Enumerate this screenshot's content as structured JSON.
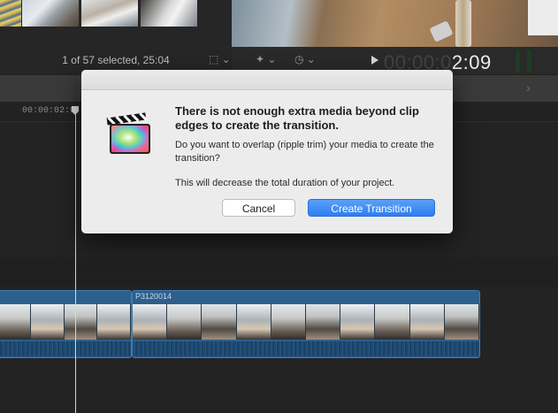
{
  "browser": {
    "selection_status": "1 of 57 selected, 25:04"
  },
  "viewer": {
    "timecode_dim": "00:00:0",
    "timecode_bright": "2:09",
    "tools": {
      "transform": "⬚ ⌄",
      "effects": "✦ ⌄",
      "speed": "◷ ⌄"
    }
  },
  "timeline": {
    "ruler_time": "00:00:02:0",
    "clip_name": "P3120014"
  },
  "dialog": {
    "title": "There is not enough extra media beyond clip edges to create the transition.",
    "question": "Do you want to overlap (ripple trim) your media to create the transition?",
    "note": "This will decrease the total duration of your project.",
    "cancel_label": "Cancel",
    "create_label": "Create Transition"
  },
  "colors": {
    "accent": "#2f7ef0",
    "clip": "#2d5f8d"
  }
}
